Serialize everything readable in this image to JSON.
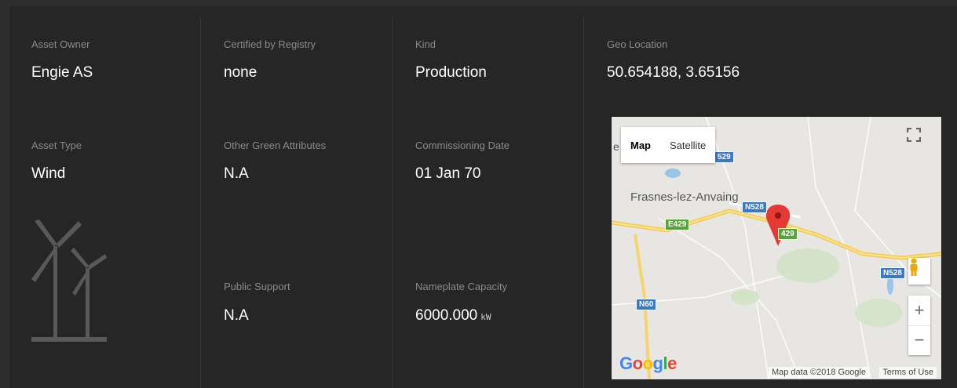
{
  "fields": {
    "asset_owner": {
      "label": "Asset Owner",
      "value": "Engie AS"
    },
    "certified_by_registry": {
      "label": "Certified by Registry",
      "value": "none"
    },
    "kind": {
      "label": "Kind",
      "value": "Production"
    },
    "geo_location": {
      "label": "Geo Location",
      "value": "50.654188, 3.65156"
    },
    "asset_type": {
      "label": "Asset Type",
      "value": "Wind"
    },
    "other_green_attributes": {
      "label": "Other Green Attributes",
      "value": "N.A"
    },
    "commissioning_date": {
      "label": "Commissioning Date",
      "value": "01 Jan 70"
    },
    "public_support": {
      "label": "Public Support",
      "value": "N.A"
    },
    "nameplate_capacity": {
      "label": "Nameplate Capacity",
      "value": "6000.000",
      "unit": "kW"
    }
  },
  "map": {
    "tabs": [
      "Map",
      "Satellite"
    ],
    "active_tab": "Map",
    "place_name": "Frasnes-lez-Anvaing",
    "place_partial": "e",
    "roads": [
      "529",
      "N528",
      "E429",
      "429",
      "N528",
      "N60"
    ],
    "google_logo": "Google",
    "attribution": "Map data ©2018 Google",
    "terms": "Terms of Use",
    "controls": {
      "fullscreen": "fullscreen-icon",
      "pegman": "pegman-icon",
      "zoom_in": "+",
      "zoom_out": "−"
    }
  },
  "colors": {
    "background": "#262626",
    "label": "#8a8a8a",
    "value": "#ffffff",
    "marker": "#e53935"
  }
}
